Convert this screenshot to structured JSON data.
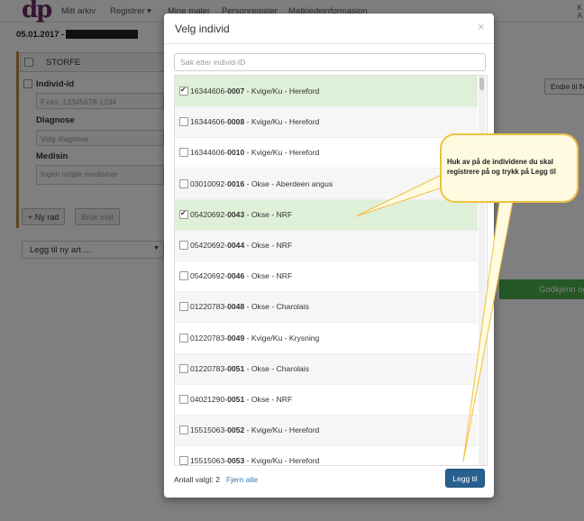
{
  "nav": {
    "logo": "dp",
    "items": [
      "Mitt arkiv",
      "Registrer ▾",
      "Mine maler",
      "Personregister",
      "Matkjedeinformasjon"
    ],
    "right_line1": "K",
    "right_line2": "A"
  },
  "header": {
    "date": "05.01.2017 -"
  },
  "background_form": {
    "species_header": "STORFE",
    "individ_label": "Individ-id",
    "individ_placeholder": "F.eks. 12345678-1234",
    "diagnose_label": "Diagnose",
    "diagnose_placeholder": "Velg diagnose",
    "medisin_label": "Medisin",
    "medisin_placeholder": "Ingen valgte medisiner",
    "ny_rad": "+ Ny rad",
    "bruk_mal": "Bruk mal",
    "legg_til_art": "Legg til ny art ...",
    "endre": "Endre til flo",
    "godkjenn": "Godkjenn og"
  },
  "modal": {
    "title": "Velg individ",
    "close": "×",
    "search_placeholder": "Søk etter individ-ID",
    "rows": [
      {
        "prefix": "16344606-",
        "num": "0007",
        "desc": " - Kvige/Ku - Hereford",
        "checked": true
      },
      {
        "prefix": "16344606-",
        "num": "0008",
        "desc": " - Kvige/Ku - Hereford",
        "checked": false
      },
      {
        "prefix": "16344606-",
        "num": "0010",
        "desc": " - Kvige/Ku - Hereford",
        "checked": false
      },
      {
        "prefix": "03010092-",
        "num": "0016",
        "desc": " - Okse - Aberdeen angus",
        "checked": false
      },
      {
        "prefix": "05420692-",
        "num": "0043",
        "desc": " - Okse - NRF",
        "checked": true
      },
      {
        "prefix": "05420692-",
        "num": "0044",
        "desc": " - Okse - NRF",
        "checked": false
      },
      {
        "prefix": "05420692-",
        "num": "0046",
        "desc": " - Okse - NRF",
        "checked": false
      },
      {
        "prefix": "01220783-",
        "num": "0048",
        "desc": " - Okse - Charolais",
        "checked": false
      },
      {
        "prefix": "01220783-",
        "num": "0049",
        "desc": " - Kvige/Ku - Krysning",
        "checked": false
      },
      {
        "prefix": "01220783-",
        "num": "0051",
        "desc": " - Okse - Charolais",
        "checked": false
      },
      {
        "prefix": "04021290-",
        "num": "0051",
        "desc": " - Okse - NRF",
        "checked": false
      },
      {
        "prefix": "15515063-",
        "num": "0052",
        "desc": " - Kvige/Ku - Hereford",
        "checked": false
      },
      {
        "prefix": "15515063-",
        "num": "0053",
        "desc": " - Kvige/Ku - Hereford",
        "checked": false
      }
    ],
    "footer_count_label": "Antall valgt: 2",
    "fjern_alle": "Fjern alle",
    "legg_til": "Legg til"
  },
  "callout": {
    "text": "Huk av på de individene du skal registrere på og trykk på Legg til"
  },
  "colors": {
    "selected_row": "#dff0d8",
    "primary_button": "#286090",
    "link": "#337ab7",
    "callout_fill": "#fffbe0",
    "callout_border": "#f0c040",
    "brand": "#6a2a63"
  }
}
